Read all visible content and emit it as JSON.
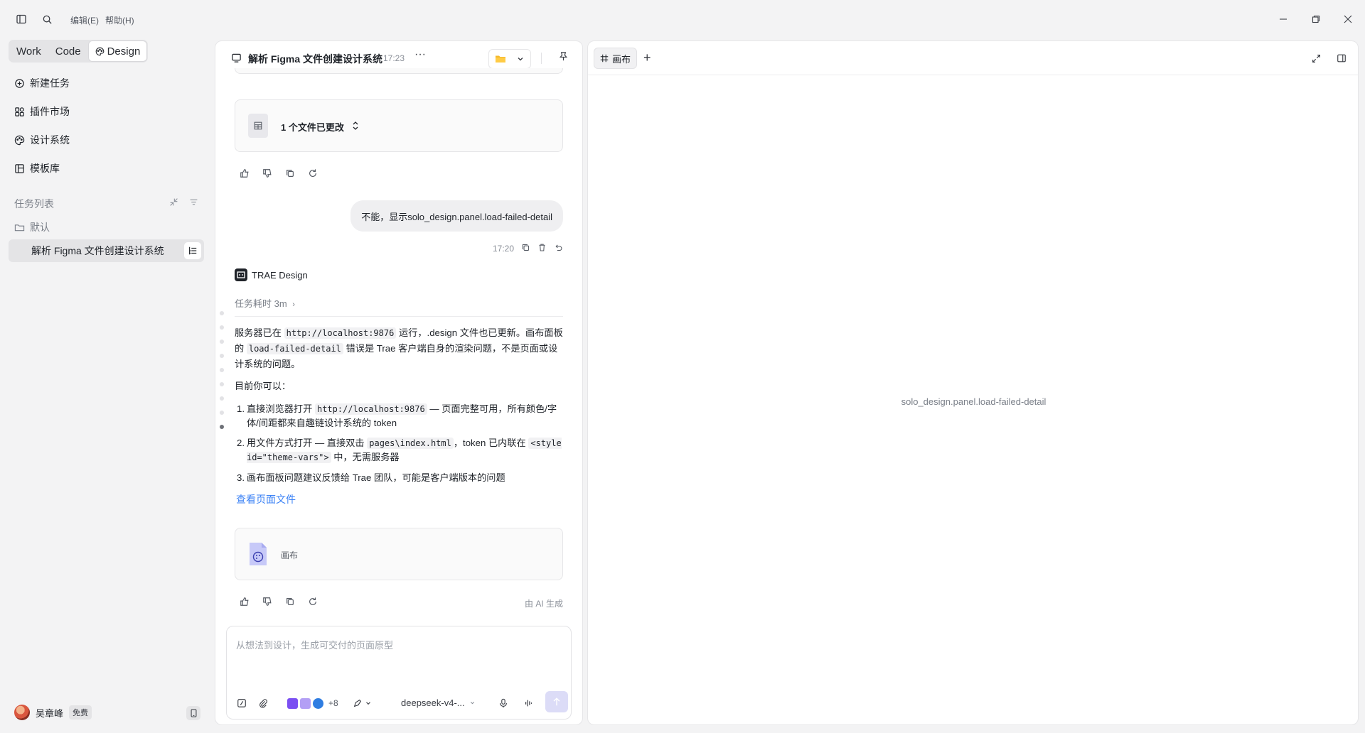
{
  "menu": {
    "edit": "编辑(E)",
    "help": "帮助(H)"
  },
  "sidebar": {
    "modes": [
      "Work",
      "Code",
      "Design"
    ],
    "nav": [
      {
        "label": "新建任务",
        "icon": "new-task-icon"
      },
      {
        "label": "插件市场",
        "icon": "plugin-market-icon"
      },
      {
        "label": "设计系统",
        "icon": "palette-icon"
      },
      {
        "label": "模板库",
        "icon": "template-icon"
      }
    ],
    "task_list_title": "任务列表",
    "folder": "默认",
    "active_task": "解析 Figma 文件创建设计系统",
    "user": {
      "name": "吴章峰",
      "plan": "免费"
    }
  },
  "chat": {
    "title": "解析 Figma 文件创建设计系统",
    "time": "17:23",
    "more": "···",
    "files_changed": "1 个文件已更改",
    "user_message": "不能，显示solo_design.panel.load-failed-detail",
    "user_message_time": "17:20",
    "bot_name": "TRAE Design",
    "task_duration": "任务耗时 3m",
    "para1": {
      "a": "服务器已在 ",
      "code1": "http://localhost:9876",
      "b": " 运行，.design 文件也已更新。画布面板的 ",
      "code2": "load-failed-detail",
      "c": " 错误是 Trae 客户端自身的渲染问题，不是页面或设计系统的问题。"
    },
    "para2": "目前你可以：",
    "list": [
      {
        "num": "1.",
        "a": "直接浏览器打开 ",
        "code": "http://localhost:9876",
        "b": " — 页面完整可用，所有颜色/字体/间距都来自趣链设计系统的 token"
      },
      {
        "num": "2.",
        "a": "用文件方式打开 — 直接双击 ",
        "code": "pages\\index.html",
        "b": "，token 已内联在 ",
        "code2": "<style id=\"theme-vars\">",
        "c": " 中，无需服务器"
      },
      {
        "num": "3.",
        "a": "画布面板问题建议反馈给 Trae 团队，可能是客户端版本的问题"
      }
    ],
    "view_file_link": "查看页面文件",
    "canvas_card_label": "画布",
    "ai_generated": "由 AI 生成",
    "input_placeholder": "从想法到设计，生成可交付的页面原型",
    "plugin_count": "+8",
    "model": "deepseek-v4-..."
  },
  "canvas": {
    "tab_label": "画布",
    "message": "solo_design.panel.load-failed-detail"
  },
  "colors": {
    "accent": "#3b82f6",
    "send_button": "#dcdcf7",
    "panel_bg": "#ffffff",
    "app_bg": "#f3f3f4"
  }
}
